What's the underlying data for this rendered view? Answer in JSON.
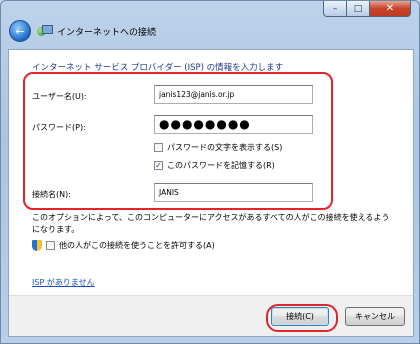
{
  "window": {
    "title": "インターネットへの接続",
    "controls": {
      "minimize": "–",
      "maximize": "□",
      "close": "✕"
    }
  },
  "heading": "インターネット サービス プロバイダー (ISP) の情報を入力します",
  "form": {
    "username_label": "ユーザー名(U):",
    "username_value": "janis123@janis.or.jp",
    "password_label": "パスワード(P):",
    "password_value": "●●●●●●●●",
    "show_password_label": "パスワードの文字を表示する(S)",
    "show_password_checked": false,
    "remember_password_label": "このパスワードを記憶する(R)",
    "remember_password_checked": true,
    "connection_name_label": "接続名(N):",
    "connection_name_value": "JANIS"
  },
  "note": {
    "text": "このオプションによって、このコンピューターにアクセスがあるすべての人がこの接続を使えるようになります。",
    "allow_others_label": "他の人がこの接続を使うことを許可する(A)",
    "allow_others_checked": false
  },
  "link": "ISP がありません",
  "buttons": {
    "connect": "接続(C)",
    "cancel": "キャンセル"
  },
  "colors": {
    "highlight_ring": "#e0252b",
    "heading": "#1f3b8a",
    "link": "#1a51b8"
  }
}
